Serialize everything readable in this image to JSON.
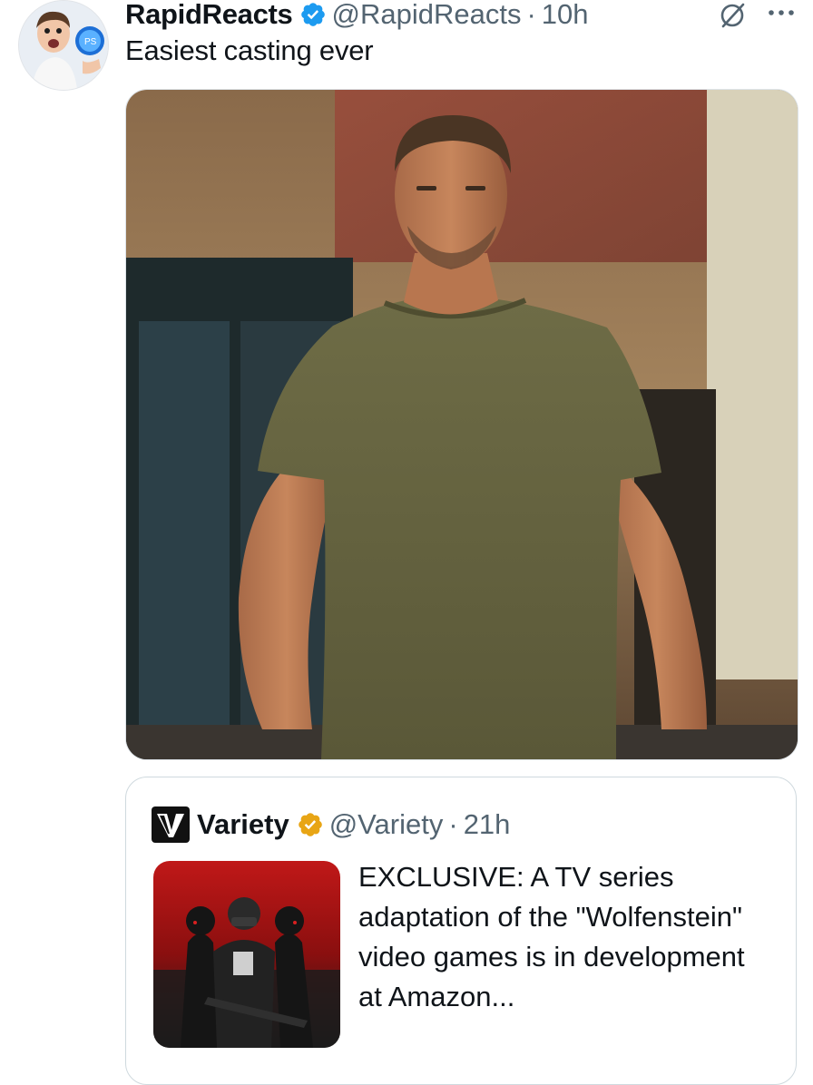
{
  "tweet": {
    "display_name": "RapidReacts",
    "handle": "@RapidReacts",
    "separator": "·",
    "time": "10h",
    "text": "Easiest casting ever",
    "avatar_icon": "avatar-icon",
    "verified_icon": "verified-badge-icon",
    "grok_icon": "grok-icon",
    "more_icon": "more-icon"
  },
  "quoted": {
    "display_name": "Variety",
    "handle": "@Variety",
    "separator": "·",
    "time": "21h",
    "text": "EXCLUSIVE: A TV series adaptation of the \"Wolfenstein\" video games is in development at Amazon...",
    "logo_icon": "variety-logo-icon",
    "verified_icon": "gold-verified-badge-icon"
  },
  "colors": {
    "verified_blue": "#1d9bf0",
    "verified_gold": "#e8a515",
    "secondary_text": "#536471"
  }
}
